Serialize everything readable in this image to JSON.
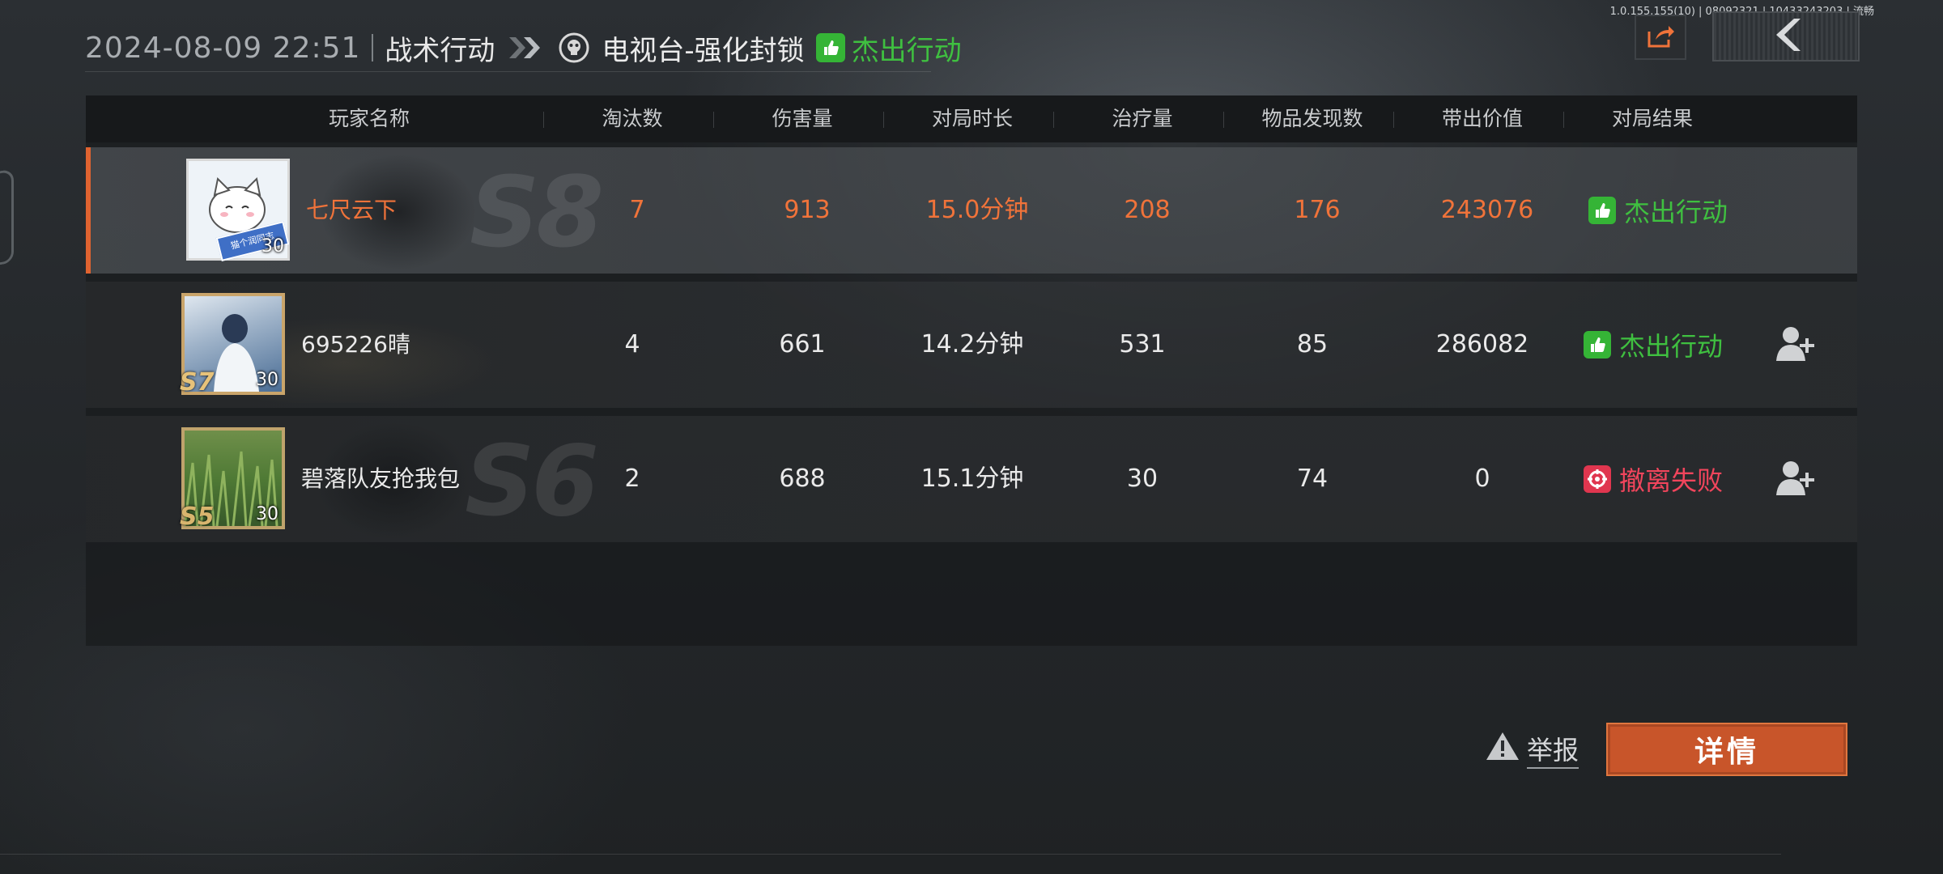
{
  "debug_info": "1.0.155.155(10) | 08092321 | 10433243203 | 流畅",
  "header": {
    "datetime": "2024-08-09 22:51",
    "mode": "战术行动",
    "map": "电视台-强化封锁",
    "result": "杰出行动"
  },
  "columns": [
    "玩家名称",
    "淘汰数",
    "伤害量",
    "对局时长",
    "治疗量",
    "物品发现数",
    "带出价值",
    "对局结果"
  ],
  "players": [
    {
      "name": "七尺云下",
      "season": "S8",
      "level": "30",
      "sticker": "猫个润同志",
      "eliminations": "7",
      "damage": "913",
      "duration": "15.0分钟",
      "healing": "208",
      "items_found": "176",
      "extract_value": "243076",
      "result": "杰出行动",
      "result_type": "success"
    },
    {
      "name": "695226晴",
      "season": "S7",
      "level": "30",
      "eliminations": "4",
      "damage": "661",
      "duration": "14.2分钟",
      "healing": "531",
      "items_found": "85",
      "extract_value": "286082",
      "result": "杰出行动",
      "result_type": "success"
    },
    {
      "name": "碧落队友抢我包",
      "season": "S6",
      "level": "30",
      "frame_badge": "S5",
      "eliminations": "2",
      "damage": "688",
      "duration": "15.1分钟",
      "healing": "30",
      "items_found": "74",
      "extract_value": "0",
      "result": "撤离失败",
      "result_type": "fail"
    }
  ],
  "actions": {
    "report": "举报",
    "detail": "详情"
  },
  "colors": {
    "accent": "#c8552a",
    "self_highlight": "#f0733a",
    "success": "#3fc040",
    "fail": "#f2455c"
  }
}
